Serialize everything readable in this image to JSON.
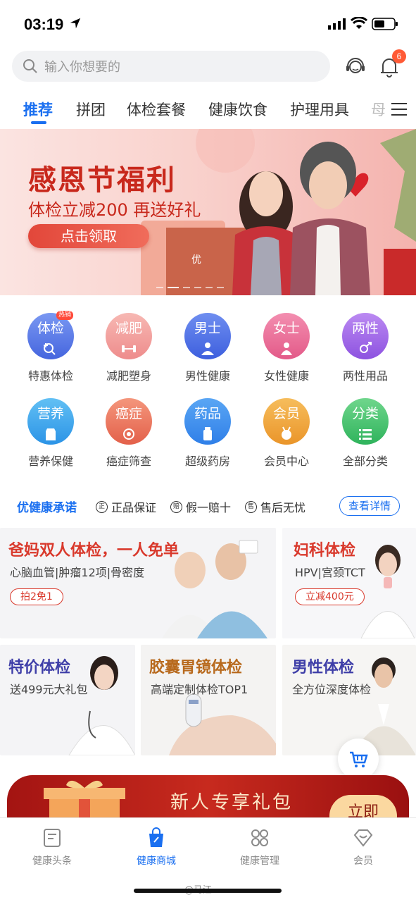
{
  "status": {
    "time": "03:19"
  },
  "search": {
    "placeholder": "输入你想要的",
    "notif_count": "6"
  },
  "tabs": [
    "推荐",
    "拼团",
    "体检套餐",
    "健康饮食",
    "护理用具",
    "母"
  ],
  "banner": {
    "title": "感恩节福利",
    "subtitle": "体检立减200 再送好礼",
    "button": "点击领取",
    "bag_logo": "优"
  },
  "categories": [
    {
      "icon_text": "体检",
      "label": "特惠体检",
      "color": "#5b7fe8",
      "hot": "热销"
    },
    {
      "icon_text": "减肥",
      "label": "减肥塑身",
      "color": "#f09a9a"
    },
    {
      "icon_text": "男士",
      "label": "男性健康",
      "color": "#4f6fe6"
    },
    {
      "icon_text": "女士",
      "label": "女性健康",
      "color": "#ec6f96"
    },
    {
      "icon_text": "两性",
      "label": "两性用品",
      "color": "#a36be6"
    },
    {
      "icon_text": "营养",
      "label": "营养保健",
      "color": "#3aa7ea"
    },
    {
      "icon_text": "癌症",
      "label": "癌症筛查",
      "color": "#ee7a62"
    },
    {
      "icon_text": "药品",
      "label": "超级药房",
      "color": "#3a8ff0"
    },
    {
      "icon_text": "会员",
      "label": "会员中心",
      "color": "#f0a33c"
    },
    {
      "icon_text": "分类",
      "label": "全部分类",
      "color": "#3fc26a"
    }
  ],
  "promise": {
    "title": "优健康承诺",
    "items": [
      {
        "mark": "正",
        "text": "正品保证"
      },
      {
        "mark": "赔",
        "text": "假一赔十"
      },
      {
        "mark": "售",
        "text": "售后无忧"
      }
    ],
    "button": "查看详情"
  },
  "cards": [
    {
      "title": "爸妈双人体检，一人免单",
      "sub": "心脑血管|肿瘤12项|骨密度",
      "tag": "拍2免1",
      "title_color": "#d9392c"
    },
    {
      "title": "妇科体检",
      "sub": "HPV|宫颈TCT",
      "tag": "立减400元",
      "title_color": "#d9392c"
    },
    {
      "title": "特价体检",
      "sub": "送499元大礼包",
      "title_color": "#3f3fa8"
    },
    {
      "title": "胶囊胃镜体检",
      "sub": "高端定制体检TOP1",
      "title_color": "#b86a1e"
    },
    {
      "title": "男性体检",
      "sub": "全方位深度体检",
      "title_color": "#3f3fa8"
    }
  ],
  "gift": {
    "title": "新人专享礼包",
    "button": "立即"
  },
  "tabbar": [
    {
      "label": "健康头条",
      "icon": "news-icon"
    },
    {
      "label": "健康商城",
      "icon": "shopping-bag-icon",
      "active": true
    },
    {
      "label": "健康管理",
      "icon": "grid-icon"
    },
    {
      "label": "会员",
      "icon": "member-icon"
    }
  ],
  "watermark": "@马江"
}
